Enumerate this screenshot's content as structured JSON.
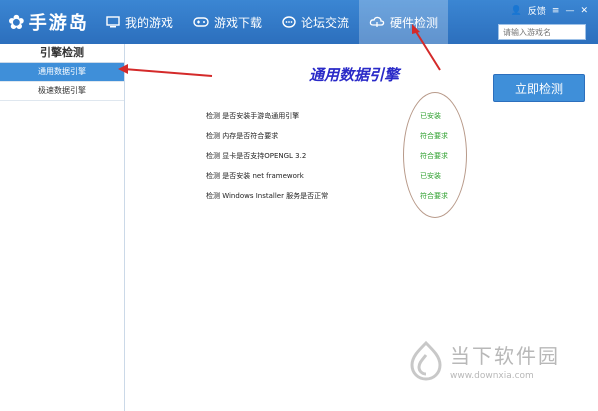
{
  "app": {
    "logo_text": "手游岛"
  },
  "nav": [
    {
      "label": "我的游戏",
      "icon": "monitor-icon"
    },
    {
      "label": "游戏下载",
      "icon": "gamepad-icon"
    },
    {
      "label": "论坛交流",
      "icon": "chat-icon"
    },
    {
      "label": "硬件检测",
      "icon": "cloud-icon"
    }
  ],
  "window": {
    "feedback": "反馈",
    "menu": "≡",
    "minimize": "—",
    "close": "✕"
  },
  "search": {
    "placeholder": "请输入游戏名"
  },
  "sidebar": {
    "title": "引擎检测",
    "items": [
      {
        "label": "通用数据引擎"
      },
      {
        "label": "极速数据引擎"
      }
    ]
  },
  "main": {
    "heading": "通用数据引擎",
    "detect_button": "立即检测",
    "checks": [
      {
        "text": "检测 是否安装手游岛通用引擎",
        "status": "已安装"
      },
      {
        "text": "检测 内存是否符合要求",
        "status": "符合要求"
      },
      {
        "text": "检测 显卡是否支持OPENGL 3.2",
        "status": "符合要求"
      },
      {
        "text": "检测 是否安装 net framework",
        "status": "已安装"
      },
      {
        "text": "检测 Windows Installer 服务是否正常",
        "status": "符合要求"
      }
    ]
  },
  "watermark": {
    "name": "当下软件园",
    "url": "www.downxia.com"
  },
  "colors": {
    "topbar": "#2c6fbd",
    "accent": "#3f8fd9",
    "status_ok": "#2ea02e",
    "annotation": "#d42a2a",
    "heading": "#2a2ac8"
  }
}
